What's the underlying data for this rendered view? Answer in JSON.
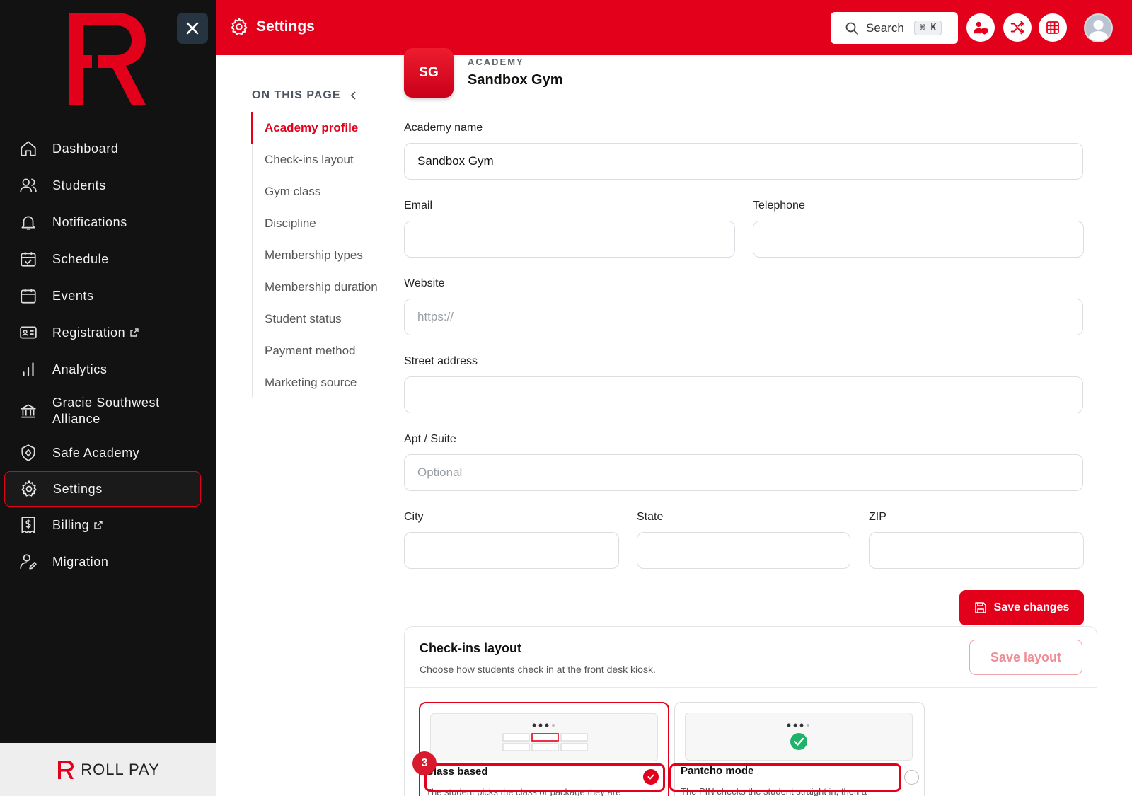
{
  "header": {
    "title": "Settings",
    "search_label": "Search",
    "shortcut": "⌘ K"
  },
  "sidebar": {
    "items": [
      {
        "label": "Dashboard",
        "icon": "home-icon"
      },
      {
        "label": "Students",
        "icon": "users-icon"
      },
      {
        "label": "Notifications",
        "icon": "bell-icon"
      },
      {
        "label": "Schedule",
        "icon": "calendar-check-icon"
      },
      {
        "label": "Events",
        "icon": "calendar-icon"
      },
      {
        "label": "Registration",
        "icon": "id-card-icon",
        "external": true
      },
      {
        "label": "Analytics",
        "icon": "bar-chart-icon"
      },
      {
        "label": "Gracie Southwest Alliance",
        "icon": "institution-icon"
      },
      {
        "label": "Safe Academy",
        "icon": "shield-icon"
      },
      {
        "label": "Settings",
        "icon": "gear-icon",
        "active": true
      },
      {
        "label": "Billing",
        "icon": "receipt-dollar-icon",
        "external": true
      },
      {
        "label": "Migration",
        "icon": "user-edit-icon"
      }
    ],
    "footer_brand": "ROLL PAY"
  },
  "on_this_page": {
    "heading": "ON THIS PAGE",
    "items": [
      "Academy profile",
      "Check-ins layout",
      "Gym class",
      "Discipline",
      "Membership types",
      "Membership duration",
      "Student status",
      "Payment method",
      "Marketing source"
    ],
    "active_index": 0
  },
  "academy": {
    "initials": "SG",
    "kicker": "ACADEMY",
    "name": "Sandbox Gym"
  },
  "form": {
    "academy_name_label": "Academy name",
    "academy_name_value": "Sandbox Gym",
    "email_label": "Email",
    "email_value": "",
    "telephone_label": "Telephone",
    "telephone_value": "",
    "website_label": "Website",
    "website_placeholder": "https://",
    "street_label": "Street address",
    "street_value": "",
    "apt_label": "Apt / Suite",
    "apt_placeholder": "Optional",
    "city_label": "City",
    "state_label": "State",
    "zip_label": "ZIP",
    "save_label": "Save changes"
  },
  "checkins": {
    "title": "Check-ins layout",
    "subtitle": "Choose how students check in at the front desk kiosk.",
    "save_layout_label": "Save layout",
    "step_number": "3",
    "options": [
      {
        "label": "Class based",
        "desc": "The student picks the class or package they are",
        "selected": true
      },
      {
        "label": "Pantcho mode",
        "desc": "The PIN checks the student straight in, then a",
        "selected": false
      }
    ]
  },
  "colors": {
    "brand_red": "#e3001b",
    "sidebar_bg": "#121212",
    "success_green": "#1db36b"
  }
}
